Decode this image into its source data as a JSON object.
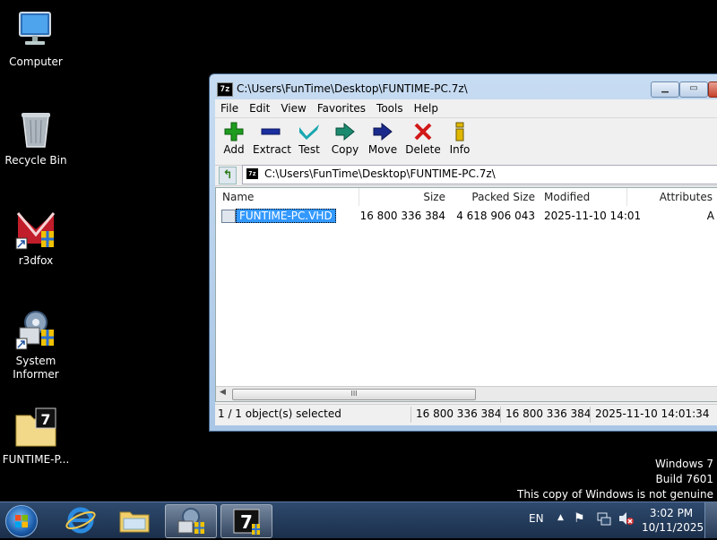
{
  "desktop": {
    "icons": [
      {
        "label": "Computer"
      },
      {
        "label": "Recycle Bin"
      },
      {
        "label": "r3dfox"
      },
      {
        "label": "System\nInformer"
      },
      {
        "label": "FUNTIME-P..."
      }
    ]
  },
  "window": {
    "title": "C:\\Users\\FunTime\\Desktop\\FUNTIME-PC.7z\\",
    "app_icon_text": "7z",
    "menu": [
      "File",
      "Edit",
      "View",
      "Favorites",
      "Tools",
      "Help"
    ],
    "toolbar": [
      {
        "label": "Add",
        "icon": "plus-icon",
        "color": "#1e9c1e"
      },
      {
        "label": "Extract",
        "icon": "minus-icon",
        "color": "#1a2fa0"
      },
      {
        "label": "Test",
        "icon": "check-icon",
        "color": "#19a7b0"
      },
      {
        "label": "Copy",
        "icon": "copy-arrow-icon",
        "color": "#1b8a6e"
      },
      {
        "label": "Move",
        "icon": "move-arrow-icon",
        "color": "#1a2a8c"
      },
      {
        "label": "Delete",
        "icon": "delete-x-icon",
        "color": "#d11818"
      },
      {
        "label": "Info",
        "icon": "info-icon",
        "color": "#c9a200"
      }
    ],
    "address": "C:\\Users\\FunTime\\Desktop\\FUNTIME-PC.7z\\",
    "columns": [
      "Name",
      "Size",
      "Packed Size",
      "Modified",
      "Attributes"
    ],
    "rows": [
      {
        "name": "FUNTIME-PC.VHD",
        "size": "16 800 336 384",
        "packed": "4 618 906 043",
        "modified": "2025-11-10 14:01",
        "attributes": "A"
      }
    ],
    "status": {
      "selection": "1 / 1 object(s) selected",
      "size": "16 800 336 384",
      "packed": "16 800 336 384",
      "modified": "2025-11-10 14:01:34"
    },
    "scroll_thumb_text": "III"
  },
  "watermark": {
    "line1": "Windows 7",
    "line2": "Build 7601",
    "line3": "This copy of Windows is not genuine"
  },
  "taskbar": {
    "language": "EN",
    "time": "3:02 PM",
    "date": "10/11/2025"
  }
}
